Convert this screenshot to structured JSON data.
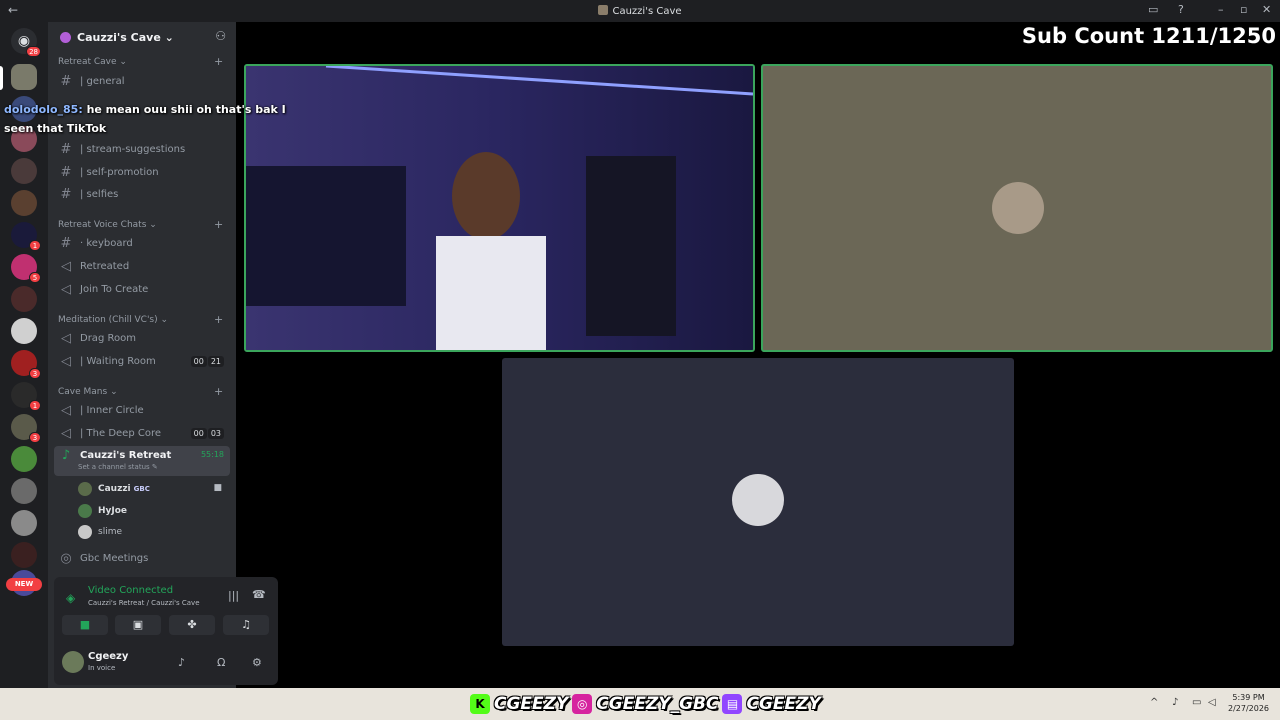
{
  "window": {
    "title": "Cauzzi's Cave"
  },
  "overlay": {
    "sub_count": "Sub Count 1211/1250",
    "chat_user": "dolodolo_85:",
    "chat_message_1": " he mean ouu shii oh that's bak I",
    "chat_message_2": "seen that TikTok"
  },
  "server": {
    "name": "Cauzzi's Cave",
    "badges": {
      "home": "28",
      "s6": "1",
      "s7": "5",
      "s10": "3",
      "s11": "1",
      "s12": "3"
    },
    "new_label": "NEW"
  },
  "categories": {
    "retreat_cave": "Retreat Cave",
    "voice_chats": "Retreat Voice Chats",
    "meditation": "Meditation (Chill VC's)",
    "cave_mans": "Cave Mans"
  },
  "channels": {
    "general": "| general",
    "stream_suggestions": "| stream-suggestions",
    "self_promotion": "| self-promotion",
    "selfies": "| selfies",
    "keyboard": "· keyboard",
    "retreated": "Retreated",
    "join_to_create": "Join To Create",
    "drag_room": "Drag Room",
    "waiting_room": "| Waiting Room",
    "waiting_room_counts": [
      "00",
      "21"
    ],
    "inner_circle": "| Inner Circle",
    "deep_core": "| The Deep Core",
    "deep_core_counts": [
      "00",
      "03"
    ],
    "cauzzis_retreat": "Cauzzi's Retreat",
    "cauzzis_retreat_timer": "55:18",
    "set_status": "Set a channel status",
    "gbc_meetings": "Gbc Meetings"
  },
  "voice_users": [
    {
      "name": "Cauzzi",
      "tag": "GBC"
    },
    {
      "name": "HyJoe",
      "tag": ""
    },
    {
      "name": "slime",
      "tag": ""
    }
  ],
  "voice_panel": {
    "status": "Video Connected",
    "location": "Cauzzi's Retreat / Cauzzi's Cave"
  },
  "user_panel": {
    "name": "Cgeezy",
    "status": "In voice"
  },
  "taskbar": {
    "handle_1": "CGEEZY",
    "handle_2": "CGEEZY_GBC",
    "handle_3": "CGEEZY",
    "time": "5:39 PM",
    "date": "2/27/2026"
  },
  "colors": {
    "accent_green": "#23a55a",
    "channel_bg": "#2b2d31",
    "server_bg": "#1e1f22"
  }
}
